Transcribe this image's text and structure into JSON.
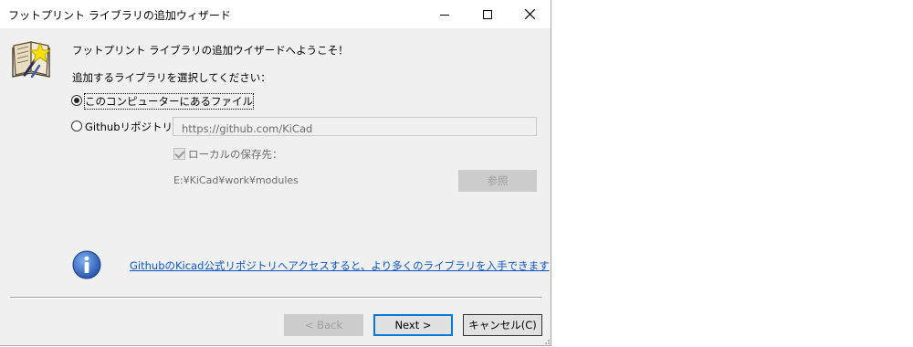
{
  "window": {
    "title": "フットプリント ライブラリの追加ウィザード"
  },
  "header": {
    "welcome": "フットプリント ライブラリの追加ウイザードへようこそ！",
    "prompt": "追加するライブラリを選択してください："
  },
  "options": {
    "local_label": "このコンピューターにあるファイル",
    "local_selected": true,
    "github_label": "Githubリポジトリ",
    "github_selected": false,
    "github_url": "https://github.com/KiCad",
    "save_local_label": "ローカルの保存先：",
    "save_local_checked": true,
    "local_path": "E:¥KiCad¥work¥modules",
    "browse_label": "参照"
  },
  "info": {
    "link_text": "GithubのKicad公式リポジトリへアクセスすると、より多くのライブラリを入手できます"
  },
  "footer": {
    "back_label": "< Back",
    "next_label": "Next >",
    "cancel_label": "キャンセル(C)"
  },
  "colors": {
    "dialog_bg": "#f0f0f0",
    "link": "#0b57c9",
    "default_button_border": "#0078d7",
    "info_icon": "#2a5fb8"
  },
  "icons": {
    "wizard": "book-wand-icon",
    "info": "info-icon"
  }
}
